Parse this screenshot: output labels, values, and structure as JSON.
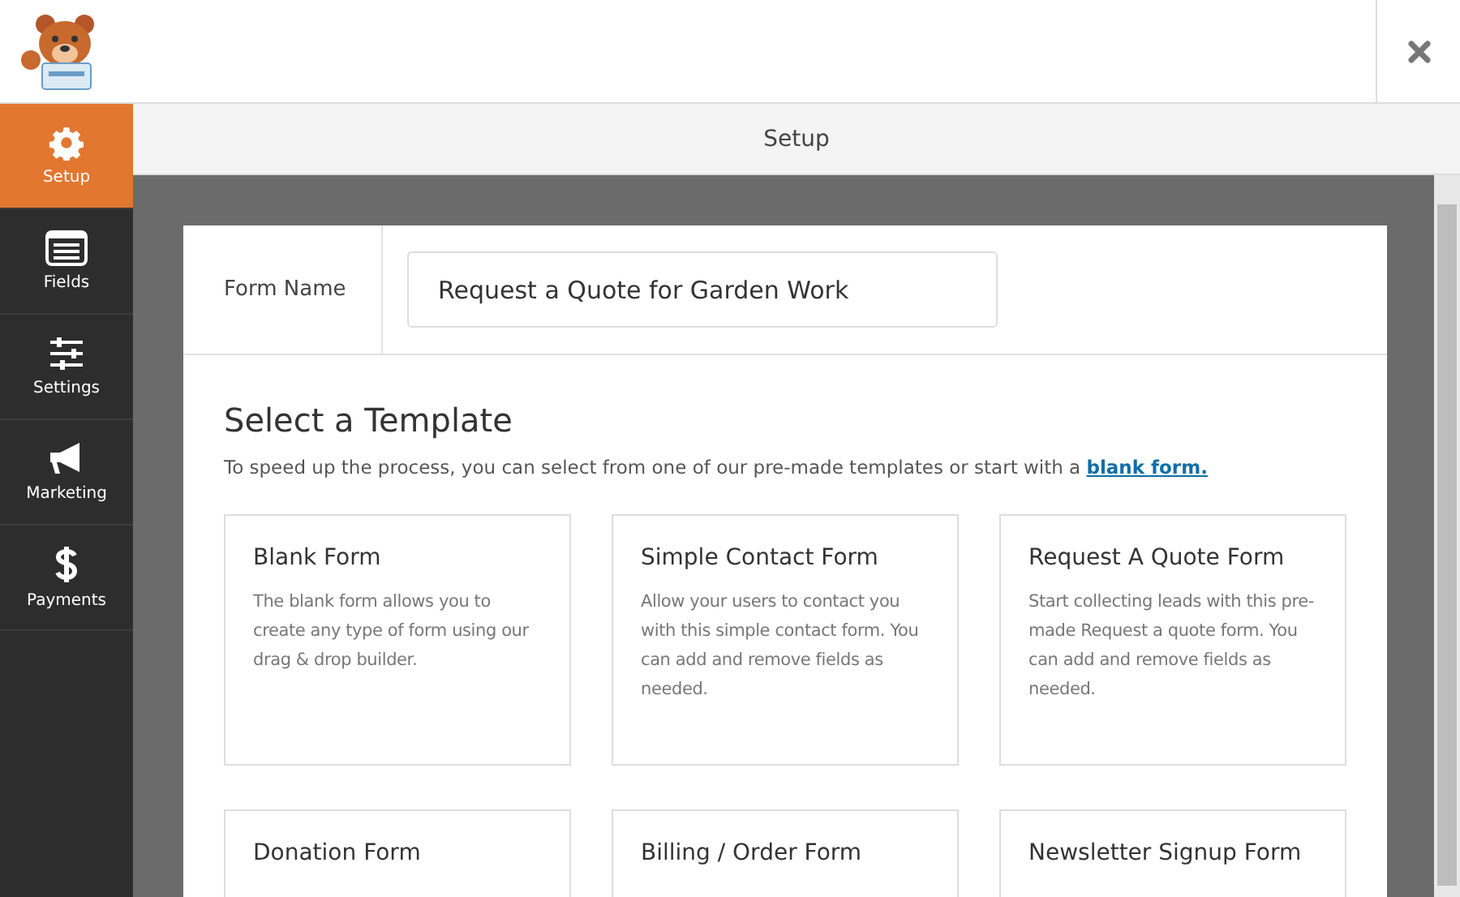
{
  "sidebar": {
    "items": [
      {
        "kind": "gear",
        "label": "Setup",
        "selected": true
      },
      {
        "kind": "list",
        "label": "Fields",
        "selected": false
      },
      {
        "kind": "sliders",
        "label": "Settings",
        "selected": false
      },
      {
        "kind": "megaphone",
        "label": "Marketing",
        "selected": false
      },
      {
        "kind": "dollar",
        "label": "Payments",
        "selected": false
      }
    ]
  },
  "title_bar": {
    "title": "Setup"
  },
  "form_name": {
    "label": "Form Name",
    "value": "Request a Quote for Garden Work"
  },
  "templates": {
    "heading": "Select a Template",
    "description": "To speed up the process, you can select from one of our pre-made templates or start with a",
    "link": "blank form.",
    "cards": [
      {
        "title": "Blank Form",
        "description": "The blank form allows you to create any type of form using our drag & drop builder."
      },
      {
        "title": "Simple Contact Form",
        "description": "Allow your users to contact you with this simple contact form. You can add and remove fields as needed."
      },
      {
        "title": "Request A Quote Form",
        "description": "Start collecting leads with this pre-made Request a quote form. You can add and remove fields as needed."
      },
      {
        "title": "Donation Form"
      },
      {
        "title": "Billing / Order Form"
      },
      {
        "title": "Newsletter Signup Form"
      }
    ]
  }
}
